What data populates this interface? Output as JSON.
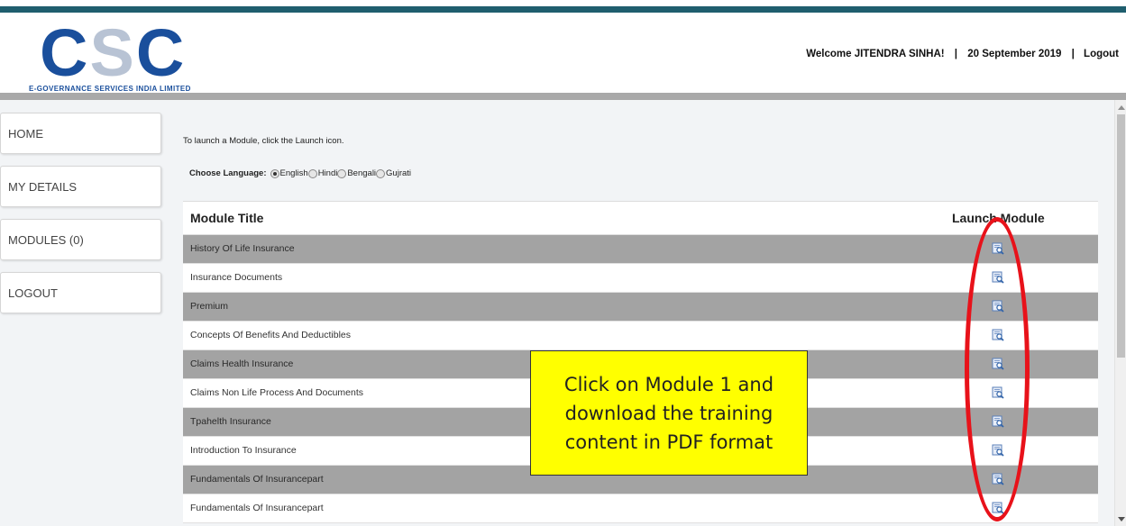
{
  "header": {
    "logo_letters": [
      "C",
      "S",
      "C"
    ],
    "logo_subtitle": "E-Governance Services India Limited",
    "welcome": "Welcome JITENDRA SINHA!",
    "date": "20 September 2019",
    "logout": "Logout",
    "separator": "|"
  },
  "sidebar": {
    "items": [
      {
        "label": "HOME"
      },
      {
        "label": "MY DETAILS"
      },
      {
        "label": "MODULES (0)"
      },
      {
        "label": "LOGOUT"
      }
    ]
  },
  "content": {
    "instruction": "To launch a Module, click the Launch icon.",
    "language_label": "Choose Language:",
    "languages": [
      "English",
      "Hindi",
      "Bengali",
      "Gujrati"
    ],
    "selected_language": "English"
  },
  "table": {
    "col_title": "Module Title",
    "col_launch": "Launch Module",
    "rows": [
      {
        "title": "History Of Life Insurance"
      },
      {
        "title": "Insurance Documents"
      },
      {
        "title": "Premium"
      },
      {
        "title": "Concepts Of Benefits And Deductibles"
      },
      {
        "title": "Claims Health Insurance"
      },
      {
        "title": "Claims Non Life Process And Documents"
      },
      {
        "title": "Tpahelth Insurance"
      },
      {
        "title": "Introduction To Insurance"
      },
      {
        "title": "Fundamentals Of Insurancepart"
      },
      {
        "title": "Fundamentals Of Insurancepart"
      }
    ]
  },
  "callout": {
    "text": "Click on Module 1 and\ndownload the training\ncontent in PDF format"
  },
  "colors": {
    "brand_blue": "#1a4f9c",
    "top_band": "#1f5e6e",
    "row_shade": "#a3a3a3",
    "callout_bg": "#ffff00",
    "highlight_oval": "#e8121a"
  }
}
